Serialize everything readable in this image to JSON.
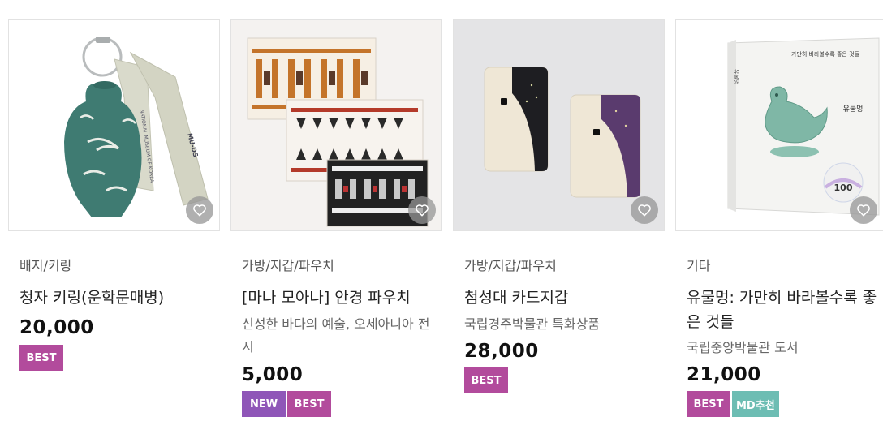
{
  "colors": {
    "best_badge": "#b24b9c",
    "new_badge": "#8f56b8",
    "md_badge": "#6dbdb3",
    "wishlist_button": "#969696"
  },
  "products": [
    {
      "category": "배지/키링",
      "title": "청자 키링(운학문매병)",
      "description": "",
      "price": "20,000",
      "badges": [
        "BEST"
      ],
      "image": "celadon-vase-keyring",
      "image_text": [
        "NATIONAL MUSEUM OF KOREA",
        "MU-DS"
      ],
      "wishlist_icon": "heart-icon"
    },
    {
      "category": "가방/지갑/파우치",
      "title": "[마나 모아나] 안경 파우치",
      "description": "신성한 바다의 예술, 오세아니아 전시",
      "price": "5,000",
      "badges": [
        "NEW",
        "BEST"
      ],
      "image": "patterned-glasses-pouches",
      "wishlist_icon": "heart-icon"
    },
    {
      "category": "가방/지갑/파우치",
      "title": "첨성대 카드지갑",
      "description": "국립경주박물관 특화상품",
      "price": "28,000",
      "badges": [
        "BEST"
      ],
      "image": "cheomseongdae-card-wallets",
      "wishlist_icon": "heart-icon"
    },
    {
      "category": "기타",
      "title": "유물멍: 가만히 바라볼수록 좋은 것들",
      "description": "국립중앙박물관 도서",
      "price": "21,000",
      "badges": [
        "BEST",
        "MD추천"
      ],
      "image": "yumulmeong-book-cover",
      "image_text": [
        "가만히 바라볼수록 좋은 것들",
        "유물멍",
        "100"
      ],
      "wishlist_icon": "heart-icon"
    }
  ]
}
